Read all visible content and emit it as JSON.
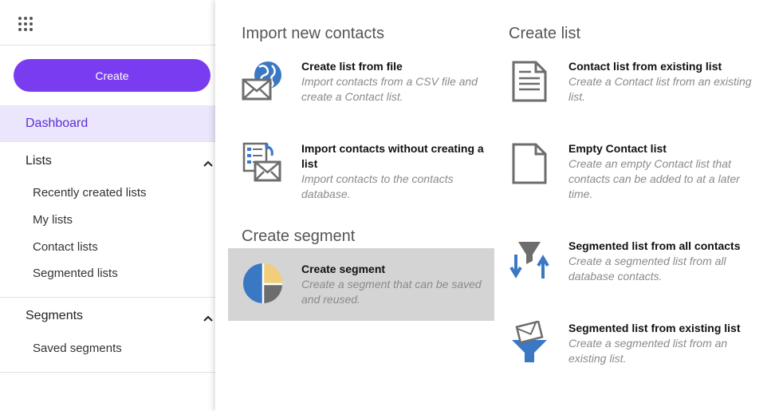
{
  "sidebar": {
    "create_label": "Create",
    "dashboard_label": "Dashboard",
    "lists": {
      "label": "Lists",
      "items": [
        "Recently created lists",
        "My lists",
        "Contact lists",
        "Segmented lists"
      ]
    },
    "segments": {
      "label": "Segments",
      "items": [
        "Saved segments"
      ]
    }
  },
  "panel": {
    "import_section": {
      "title": "Import new contacts",
      "options": [
        {
          "title": "Create list from file",
          "desc": "Import contacts from a CSV file and create a Contact list.",
          "icon": "import-file-globe-icon"
        },
        {
          "title": "Import contacts without creating a list",
          "desc": "Import contacts to the contacts database.",
          "icon": "import-contacts-icon"
        }
      ]
    },
    "segment_section": {
      "title": "Create segment",
      "options": [
        {
          "title": "Create segment",
          "desc": "Create a segment that can be saved and reused.",
          "icon": "pie-chart-icon"
        }
      ]
    },
    "list_section": {
      "title": "Create list",
      "options": [
        {
          "title": "Contact list from existing list",
          "desc": "Create a Contact list from an existing list.",
          "icon": "document-lines-icon"
        },
        {
          "title": "Empty Contact list",
          "desc": "Create an empty Contact list that contacts can be added to at a later time.",
          "icon": "blank-document-icon"
        },
        {
          "title": "Segmented list from all contacts",
          "desc": "Create a segmented list from all database contacts.",
          "icon": "funnel-arrows-icon"
        },
        {
          "title": "Segmented list from existing list",
          "desc": "Create a segmented list from an existing list.",
          "icon": "funnel-envelope-icon"
        }
      ]
    }
  },
  "colors": {
    "accent": "#7a3cf0",
    "dashboard_bg": "#ebe6fb",
    "highlight_bg": "#d4d4d4",
    "icon_blue": "#3b78c3",
    "icon_grey": "#6d6d6d",
    "icon_yellow": "#f1cf7a"
  }
}
